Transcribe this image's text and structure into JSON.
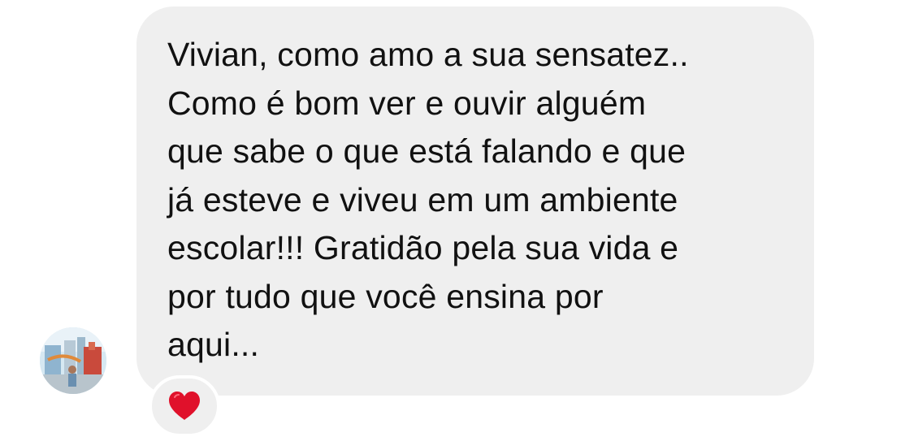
{
  "message": {
    "text": "Vivian, como amo a sua sensatez..\nComo é bom ver e ouvir alguém\nque sabe o que está falando e que\njá esteve e viveu em um ambiente\nescolar!!! Gratidão pela sua vida e\npor tudo que você ensina por\naqui...",
    "bubble_color": "#efefef",
    "text_color": "#111111"
  },
  "sender": {
    "avatar_icon": "profile-photo-avatar"
  },
  "reaction": {
    "icon": "red-heart-icon",
    "color": "#e0112b"
  }
}
